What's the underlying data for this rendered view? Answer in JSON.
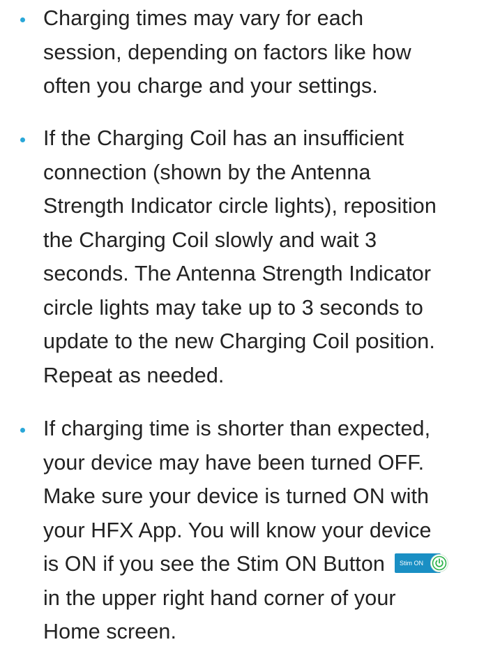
{
  "items": [
    {
      "lines": [
        "Charging times may vary for each",
        "session, depending on factors like how",
        "often you charge and your settings."
      ]
    },
    {
      "lines": [
        "If the Charging Coil has an insufficient",
        "connection (shown by the Antenna",
        "Strength Indicator circle lights), reposition",
        "the Charging Coil slowly and wait 3",
        "seconds. The Antenna Strength Indicator",
        "circle lights may take up to 3 seconds to",
        "update to the new Charging Coil position.",
        "Repeat as needed."
      ]
    },
    {
      "lines": [
        "If charging time is shorter than expected,",
        "your device may have been turned OFF.",
        "Make sure your device is turned ON with",
        "your HFX App. You will know your device",
        "is ON if you see the Stim ON Button",
        "in the upper right hand corner of your",
        "Home screen."
      ]
    }
  ],
  "stim_button": {
    "label": "Stim ON",
    "icon": "power-icon",
    "bg_color": "#1a8fc4",
    "icon_color": "#2db34a"
  },
  "colors": {
    "bullet": "#2aa7d8",
    "text": "#222222"
  }
}
